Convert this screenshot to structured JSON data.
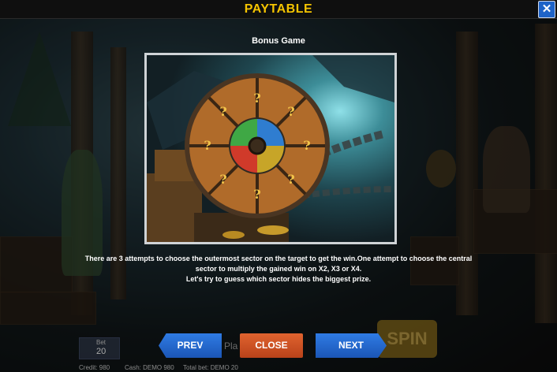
{
  "header": {
    "title": "PAYTABLE",
    "close_symbol": "✕"
  },
  "bonus": {
    "title": "Bonus Game",
    "description_lines": [
      "There are 3 attempts to choose the outermost sector on the target to get the win.One attempt to choose the central",
      "sector to multiply the gained win on  X2,  X3 or X4.",
      "Let's try to guess which sector hides the biggest prize."
    ],
    "wheel_symbols": [
      "?",
      "?",
      "?",
      "?",
      "?",
      "?",
      "?",
      "?"
    ]
  },
  "navigation": {
    "prev_label": "PREV",
    "close_label": "CLOSE",
    "next_label": "NEXT"
  },
  "background_hud": {
    "bet_label": "Bet",
    "bet_value": "20",
    "credit_text": "Credit: 980",
    "cash_text": "Cash: DEMO 980",
    "total_bet_text": "Total bet: DEMO 20",
    "spin_label": "SPIN",
    "play_partial": "Pla"
  },
  "colors": {
    "title": "#f5c400",
    "close_button": "#1e63c8",
    "nav_button": "#2f7be4",
    "close_nav_button": "#e0632f"
  }
}
